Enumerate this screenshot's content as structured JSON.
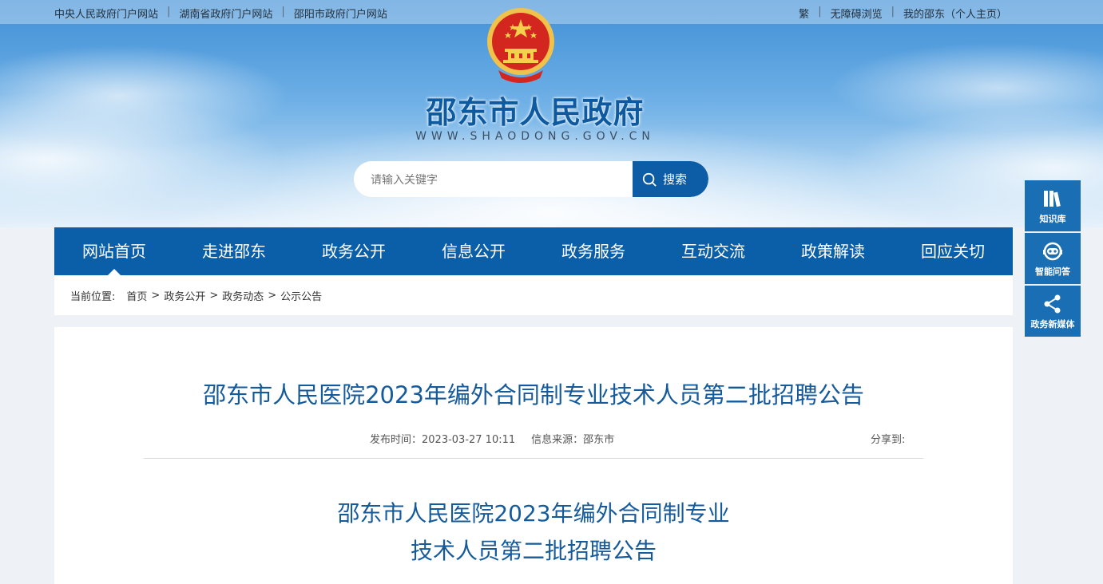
{
  "topbar": {
    "left_links": [
      "中央人民政府门户网站",
      "湖南省政府门户网站",
      "邵阳市政府门户网站"
    ],
    "right_links": [
      "繁",
      "无障碍浏览",
      "我的邵东（个人主页）"
    ]
  },
  "site": {
    "title": "邵东市人民政府",
    "url": "WWW.SHAODONG.GOV.CN"
  },
  "search": {
    "placeholder": "请输入关键字",
    "button_label": "搜索"
  },
  "nav": {
    "items": [
      "网站首页",
      "走进邵东",
      "政务公开",
      "信息公开",
      "政务服务",
      "互动交流",
      "政策解读",
      "回应关切"
    ],
    "active_index": 0
  },
  "breadcrumb": {
    "label": "当前位置:",
    "items": [
      "首页",
      "政务公开",
      "政务动态",
      "公示公告"
    ]
  },
  "article": {
    "title": "邵东市人民医院2023年编外合同制专业技术人员第二批招聘公告",
    "publish_time": "发布时间：2023-03-27 10:11",
    "source": "信息来源：邵东市",
    "share_label": "分享到:",
    "subtitle_line1": "邵东市人民医院2023年编外合同制专业",
    "subtitle_line2": "技术人员第二批招聘公告"
  },
  "side": {
    "items": [
      {
        "label": "知识库",
        "icon": "books-icon"
      },
      {
        "label": "智能问答",
        "icon": "robot-icon"
      },
      {
        "label": "政务新媒体",
        "icon": "share-icon"
      }
    ]
  },
  "colors": {
    "primary": "#0b5ea8",
    "title_blue": "#155b9c",
    "side_blue": "#1a6fb4"
  }
}
